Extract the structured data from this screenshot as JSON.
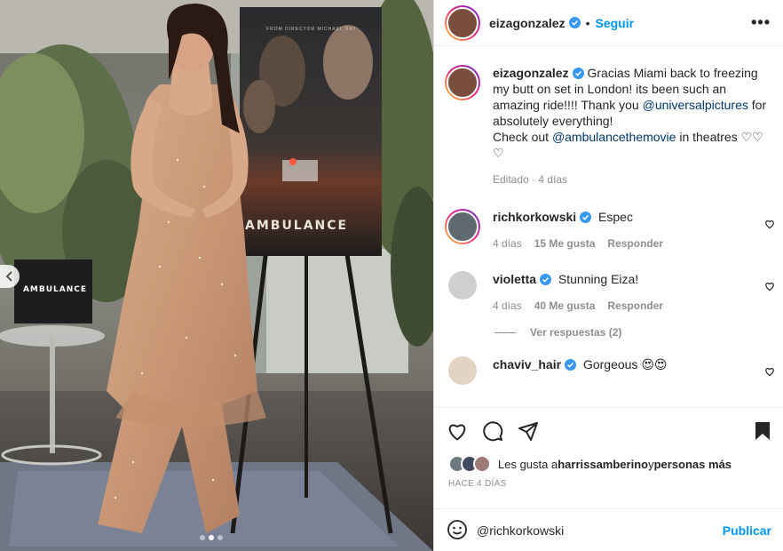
{
  "post": {
    "poster_title": "AMBULANCE",
    "poster_tagline": "FROM DIRECTOR MICHAEL BAY",
    "thumb_label": "AMBULANCE",
    "carousel": {
      "count": 3,
      "active_index": 1
    }
  },
  "header": {
    "username": "eizagonzalez",
    "separator": "•",
    "follow_label": "Seguir",
    "more_label": "•••"
  },
  "caption": {
    "username": "eizagonzalez",
    "text_1": "Gracias Miami back to freezing my butt on set in London! its been such an amazing ride!!!! Thank you ",
    "mention_1": "@universalpictures",
    "text_2": " for absolutely everything!",
    "text_3": "Check out ",
    "mention_2": "@ambulancethemovie",
    "text_4": " in theatres ♡♡ ♡",
    "meta": "Editado · 4 días"
  },
  "comments": [
    {
      "username": "richkorkowski",
      "verified": true,
      "text": "Espec",
      "time": "4 días",
      "likes": "15 Me gusta",
      "reply": "Responder"
    },
    {
      "username": "violetta",
      "verified": true,
      "text": "Stunning Eiza!",
      "time": "4 días",
      "likes": "40 Me gusta",
      "reply": "Responder",
      "view_replies": "Ver respuestas (2)"
    },
    {
      "username": "chaviv_hair",
      "verified": true,
      "text": "Gorgeous 😍😍"
    }
  ],
  "likes": {
    "prefix": "Les gusta a ",
    "user": "harrissamberino",
    "conj": " y ",
    "others": "personas más"
  },
  "timeago": "HACE 4 DÍAS",
  "composer": {
    "value": "@richkorkowski",
    "publish_label": "Publicar"
  },
  "colors": {
    "accent": "#0095f6",
    "verified": "#3897f0",
    "mention": "#00376b",
    "muted": "#8e8e8e"
  }
}
